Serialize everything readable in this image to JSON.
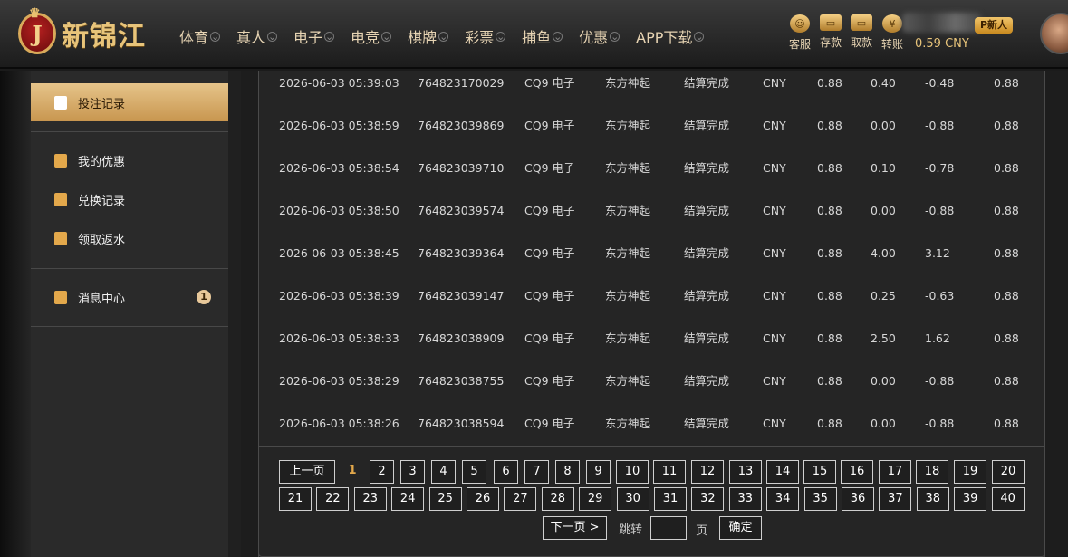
{
  "header": {
    "logo_letter": "J",
    "site_name": "新锦江",
    "nav": [
      "体育",
      "真人",
      "电子",
      "电竞",
      "棋牌",
      "彩票",
      "捕鱼",
      "优惠",
      "APP下载"
    ],
    "top_icons": [
      {
        "label": "客服",
        "icon": "customer-service-icon"
      },
      {
        "label": "存款",
        "icon": "wallet-icon"
      },
      {
        "label": "取款",
        "icon": "withdraw-icon"
      },
      {
        "label": "转账",
        "icon": "transfer-icon"
      }
    ],
    "balance": "0.59 CNY",
    "vip_badge": "P新人"
  },
  "sidebar": {
    "items": [
      {
        "label": "投注记录",
        "icon": "document-icon",
        "active": true
      },
      {
        "label": "我的优惠",
        "icon": "gift-icon"
      },
      {
        "label": "兑换记录",
        "icon": "money-bag-icon"
      },
      {
        "label": "领取返水",
        "icon": "clipboard-icon"
      },
      {
        "label": "消息中心",
        "icon": "bell-icon",
        "count": "1"
      }
    ]
  },
  "table": {
    "rows": [
      [
        "2026-06-03 05:39:03",
        "764823170029",
        "CQ9 电子",
        "东方神起",
        "结算完成",
        "CNY",
        "0.88",
        "0.40",
        "-0.48",
        "0.88"
      ],
      [
        "2026-06-03 05:38:59",
        "764823039869",
        "CQ9 电子",
        "东方神起",
        "结算完成",
        "CNY",
        "0.88",
        "0.00",
        "-0.88",
        "0.88"
      ],
      [
        "2026-06-03 05:38:54",
        "764823039710",
        "CQ9 电子",
        "东方神起",
        "结算完成",
        "CNY",
        "0.88",
        "0.10",
        "-0.78",
        "0.88"
      ],
      [
        "2026-06-03 05:38:50",
        "764823039574",
        "CQ9 电子",
        "东方神起",
        "结算完成",
        "CNY",
        "0.88",
        "0.00",
        "-0.88",
        "0.88"
      ],
      [
        "2026-06-03 05:38:45",
        "764823039364",
        "CQ9 电子",
        "东方神起",
        "结算完成",
        "CNY",
        "0.88",
        "4.00",
        "3.12",
        "0.88"
      ],
      [
        "2026-06-03 05:38:39",
        "764823039147",
        "CQ9 电子",
        "东方神起",
        "结算完成",
        "CNY",
        "0.88",
        "0.25",
        "-0.63",
        "0.88"
      ],
      [
        "2026-06-03 05:38:33",
        "764823038909",
        "CQ9 电子",
        "东方神起",
        "结算完成",
        "CNY",
        "0.88",
        "2.50",
        "1.62",
        "0.88"
      ],
      [
        "2026-06-03 05:38:29",
        "764823038755",
        "CQ9 电子",
        "东方神起",
        "结算完成",
        "CNY",
        "0.88",
        "0.00",
        "-0.88",
        "0.88"
      ],
      [
        "2026-06-03 05:38:26",
        "764823038594",
        "CQ9 电子",
        "东方神起",
        "结算完成",
        "CNY",
        "0.88",
        "0.00",
        "-0.88",
        "0.88"
      ]
    ]
  },
  "pagination": {
    "prev": "上一页",
    "current": "1",
    "pages_row1": [
      "2",
      "3",
      "4",
      "5",
      "6",
      "7",
      "8",
      "9",
      "10",
      "11",
      "12",
      "13",
      "14",
      "15",
      "16",
      "17",
      "18",
      "19",
      "20"
    ],
    "pages_row2": [
      "21",
      "22",
      "23",
      "24",
      "25",
      "26",
      "27",
      "28",
      "29",
      "30",
      "31",
      "32",
      "33",
      "34",
      "35",
      "36",
      "37",
      "38",
      "39",
      "40"
    ],
    "next": "下一页 >",
    "jump_label": "跳转",
    "page_unit": "页",
    "confirm": "确定"
  }
}
